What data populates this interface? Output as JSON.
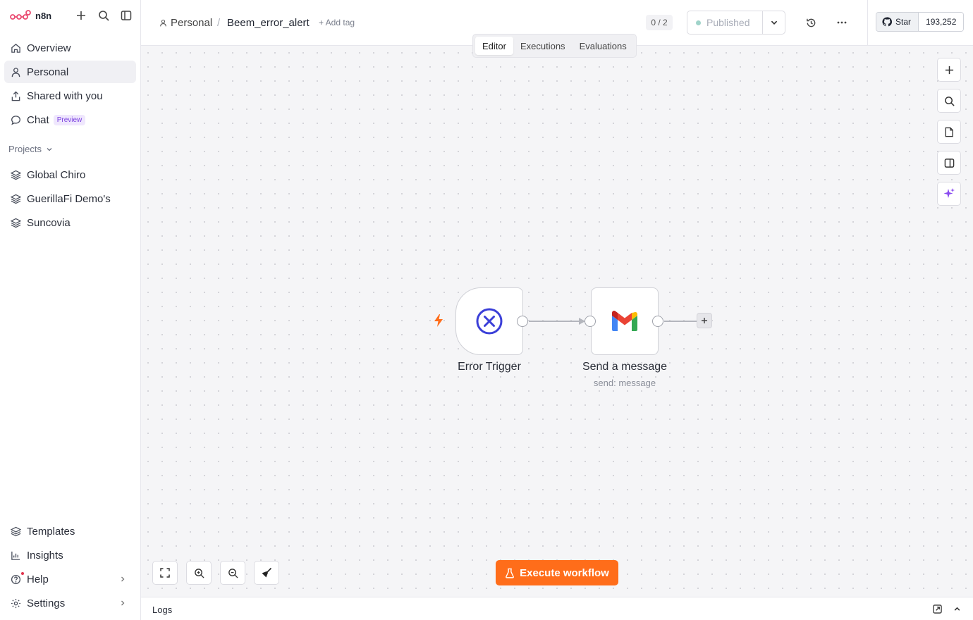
{
  "app": {
    "name": "n8n"
  },
  "sidebar": {
    "nav": [
      {
        "label": "Overview",
        "icon": "home-icon"
      },
      {
        "label": "Personal",
        "icon": "user-icon",
        "active": true
      },
      {
        "label": "Shared with you",
        "icon": "share-icon"
      },
      {
        "label": "Chat",
        "icon": "chat-icon",
        "badge": "Preview"
      }
    ],
    "projects_label": "Projects",
    "projects": [
      {
        "label": "Global Chiro",
        "icon": "layers-icon"
      },
      {
        "label": "GuerillaFi Demo's",
        "icon": "layers-icon"
      },
      {
        "label": "Suncovia",
        "icon": "layers-icon"
      }
    ],
    "bottom": [
      {
        "label": "Templates",
        "icon": "templates-icon"
      },
      {
        "label": "Insights",
        "icon": "chart-icon"
      },
      {
        "label": "Help",
        "icon": "help-icon"
      },
      {
        "label": "Settings",
        "icon": "gear-icon"
      }
    ]
  },
  "header": {
    "breadcrumb_project": "Personal",
    "breadcrumb_separator": "/",
    "workflow_name": "Beem_error_alert",
    "add_tag": "+ Add tag",
    "count": "0 / 2",
    "publish_label": "Published",
    "github_star": "Star",
    "github_count": "193,252"
  },
  "tabs": [
    "Editor",
    "Executions",
    "Evaluations"
  ],
  "nodes": [
    {
      "label": "Error Trigger",
      "subtitle": "",
      "icon": "error-trigger-icon"
    },
    {
      "label": "Send a message",
      "subtitle": "send: message",
      "icon": "gmail-icon"
    }
  ],
  "canvas": {
    "execute_label": "Execute workflow"
  },
  "logs": {
    "label": "Logs"
  },
  "colors": {
    "accent": "#ff6d1a",
    "error_trigger": "#3b3fd8",
    "brand": "#ea4b71"
  }
}
